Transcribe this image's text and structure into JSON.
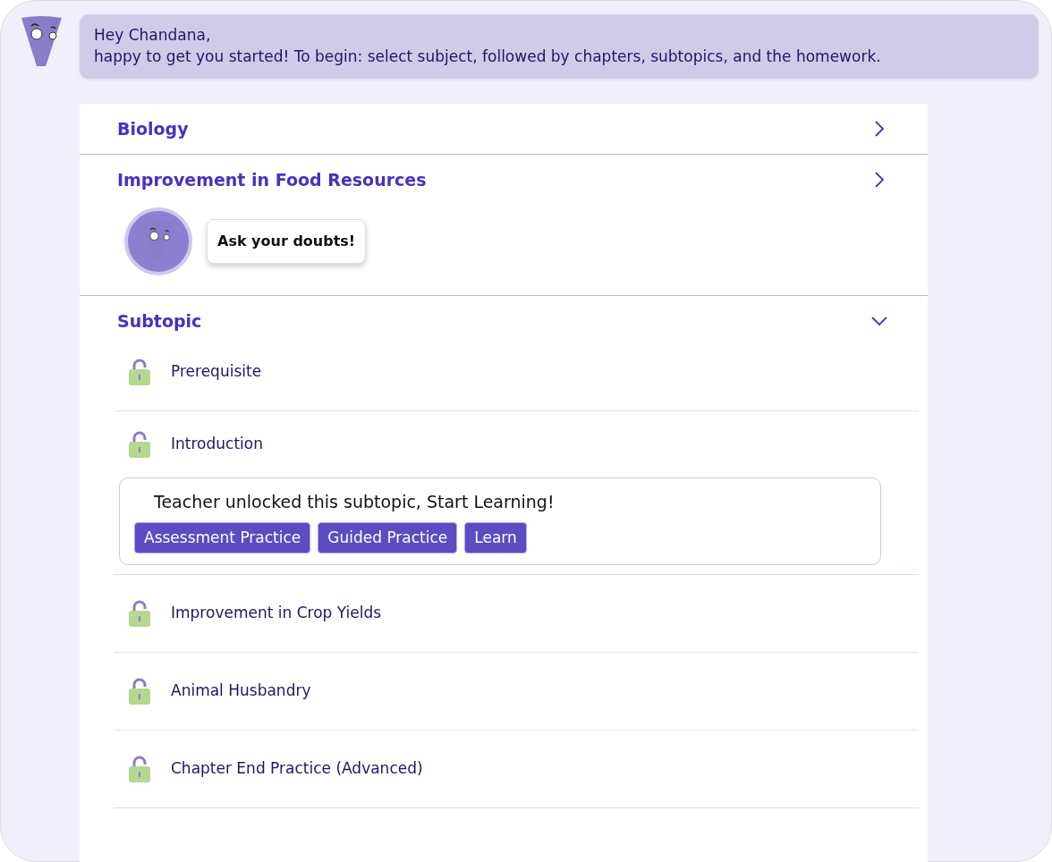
{
  "greeting": {
    "lines": [
      "Hey Chandana,",
      "happy to get you started! To begin: select subject, followed by chapters, subtopics, and the homework."
    ]
  },
  "sections": [
    {
      "title": "Biology",
      "expanded": false
    },
    {
      "title": "Improvement in Food Resources",
      "expanded": false,
      "doubts_button": "Ask your doubts!"
    }
  ],
  "subtopic_section": {
    "title": "Subtopic",
    "expanded": true,
    "items": [
      {
        "label": "Prerequisite",
        "locked": false,
        "expanded": false
      },
      {
        "label": "Introduction",
        "locked": false,
        "expanded": true,
        "notice": "Teacher unlocked this subtopic, Start Learning!",
        "actions": [
          "Assessment Practice",
          "Guided Practice",
          "Learn"
        ]
      },
      {
        "label": "Improvement in Crop Yields",
        "locked": false,
        "expanded": false
      },
      {
        "label": "Animal Husbandry",
        "locked": false,
        "expanded": false
      },
      {
        "label": "Chapter End Practice (Advanced)",
        "locked": false,
        "expanded": false
      }
    ]
  }
}
